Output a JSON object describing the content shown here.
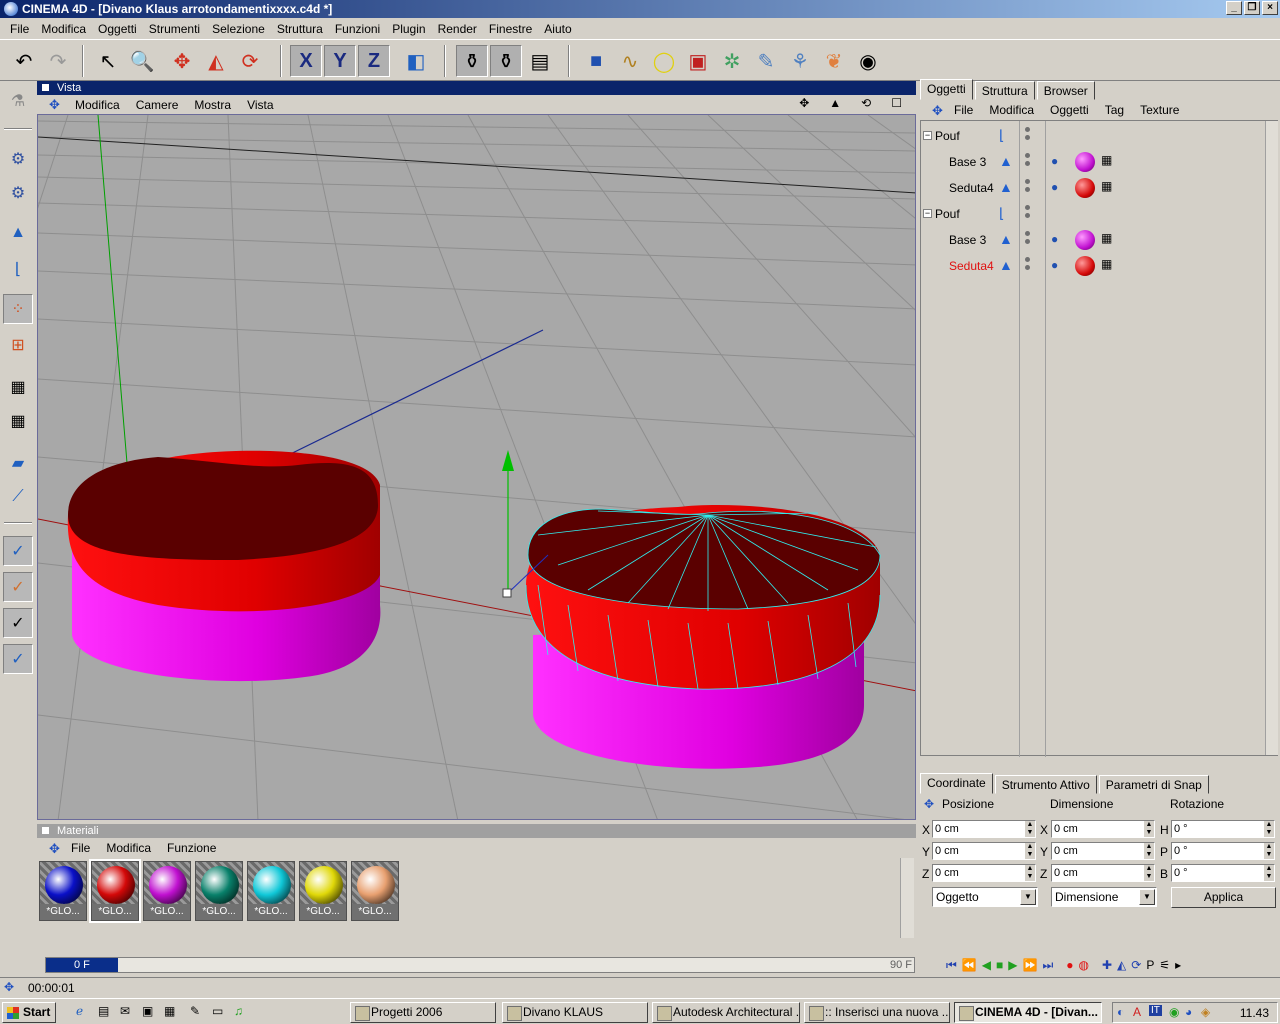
{
  "window": {
    "title": "CINEMA 4D - [Divano Klaus arrotondamentixxxx.c4d *]"
  },
  "menubar": [
    "File",
    "Modifica",
    "Oggetti",
    "Strumenti",
    "Selezione",
    "Struttura",
    "Funzioni",
    "Plugin",
    "Render",
    "Finestre",
    "Aiuto"
  ],
  "toolbar": {
    "icons": [
      "undo-icon",
      "redo-icon",
      "select-arrow-icon",
      "zoom-icon",
      "move-icon",
      "scale-icon",
      "rotate-icon",
      "x-axis-lock-icon",
      "y-axis-lock-icon",
      "z-axis-lock-icon",
      "coordinate-system-icon",
      "render-view-icon",
      "render-active-icon",
      "render-settings-icon",
      "cube-primitive-icon",
      "spline-icon",
      "nurbs-icon",
      "deformer-icon",
      "array-icon",
      "light-icon",
      "camera-icon",
      "scene-icon",
      "sound-icon"
    ],
    "x_label": "X",
    "y_label": "Y",
    "z_label": "Z"
  },
  "vista": {
    "title": "Vista",
    "menu": [
      "Modifica",
      "Camere",
      "Mostra",
      "Vista"
    ]
  },
  "materials": {
    "title": "Materiali",
    "menu": [
      "File",
      "Modifica",
      "Funzione"
    ],
    "items": [
      {
        "label": "*GLO...",
        "color": "#0a10c8"
      },
      {
        "label": "*GLO...",
        "color": "#d40808"
      },
      {
        "label": "*GLO...",
        "color": "#c010d0"
      },
      {
        "label": "*GLO...",
        "color": "#08806a"
      },
      {
        "label": "*GLO...",
        "color": "#10c8d8"
      },
      {
        "label": "*GLO...",
        "color": "#e0d808"
      },
      {
        "label": "*GLO...",
        "color": "#e8a070"
      }
    ]
  },
  "objects": {
    "tabs": [
      "Oggetti",
      "Struttura",
      "Browser"
    ],
    "menu": [
      "File",
      "Modifica",
      "Oggetti",
      "Tag",
      "Texture"
    ],
    "rows": [
      {
        "name": "Pouf",
        "level": 0,
        "icon": "null-object-icon"
      },
      {
        "name": "Base 3",
        "level": 1,
        "icon": "polygon-object-icon",
        "material": "#c010d0"
      },
      {
        "name": "Seduta4",
        "level": 1,
        "icon": "polygon-object-icon",
        "material": "#d40808"
      },
      {
        "name": "Pouf",
        "level": 0,
        "icon": "null-object-icon"
      },
      {
        "name": "Base 3",
        "level": 1,
        "icon": "polygon-object-icon",
        "material": "#c010d0"
      },
      {
        "name": "Seduta4",
        "level": 1,
        "icon": "polygon-object-icon",
        "material": "#d40808",
        "active": true
      }
    ]
  },
  "coordinates": {
    "tabs": [
      "Coordinate",
      "Strumento Attivo",
      "Parametri di Snap"
    ],
    "headers": {
      "position": "Posizione",
      "size": "Dimensione",
      "rotation": "Rotazione"
    },
    "position": {
      "x": "0 cm",
      "y": "0 cm",
      "z": "0 cm"
    },
    "size": {
      "x": "0 cm",
      "y": "0 cm",
      "z": "0 cm"
    },
    "rotation": {
      "h": "0 °",
      "p": "0 °",
      "b": "0 °"
    },
    "axis_labels": {
      "x": "X",
      "y": "Y",
      "z": "Z",
      "h": "H",
      "p": "P",
      "b": "B"
    },
    "mode_select": "Oggetto",
    "size_select": "Dimensione",
    "apply_label": "Applica"
  },
  "timeline": {
    "current_frame": "0 F",
    "end_frame": "90 F"
  },
  "status": {
    "text": "00:00:01"
  },
  "taskbar": {
    "start_label": "Start",
    "tasks": [
      {
        "label": "Progetti 2006"
      },
      {
        "label": "Divano KLAUS"
      },
      {
        "label": "Autodesk Architectural ..."
      },
      {
        "label": ":: Inserisci una nuova ..."
      },
      {
        "label": "CINEMA 4D - [Divan...",
        "active": true
      }
    ],
    "clock": "11.43"
  }
}
